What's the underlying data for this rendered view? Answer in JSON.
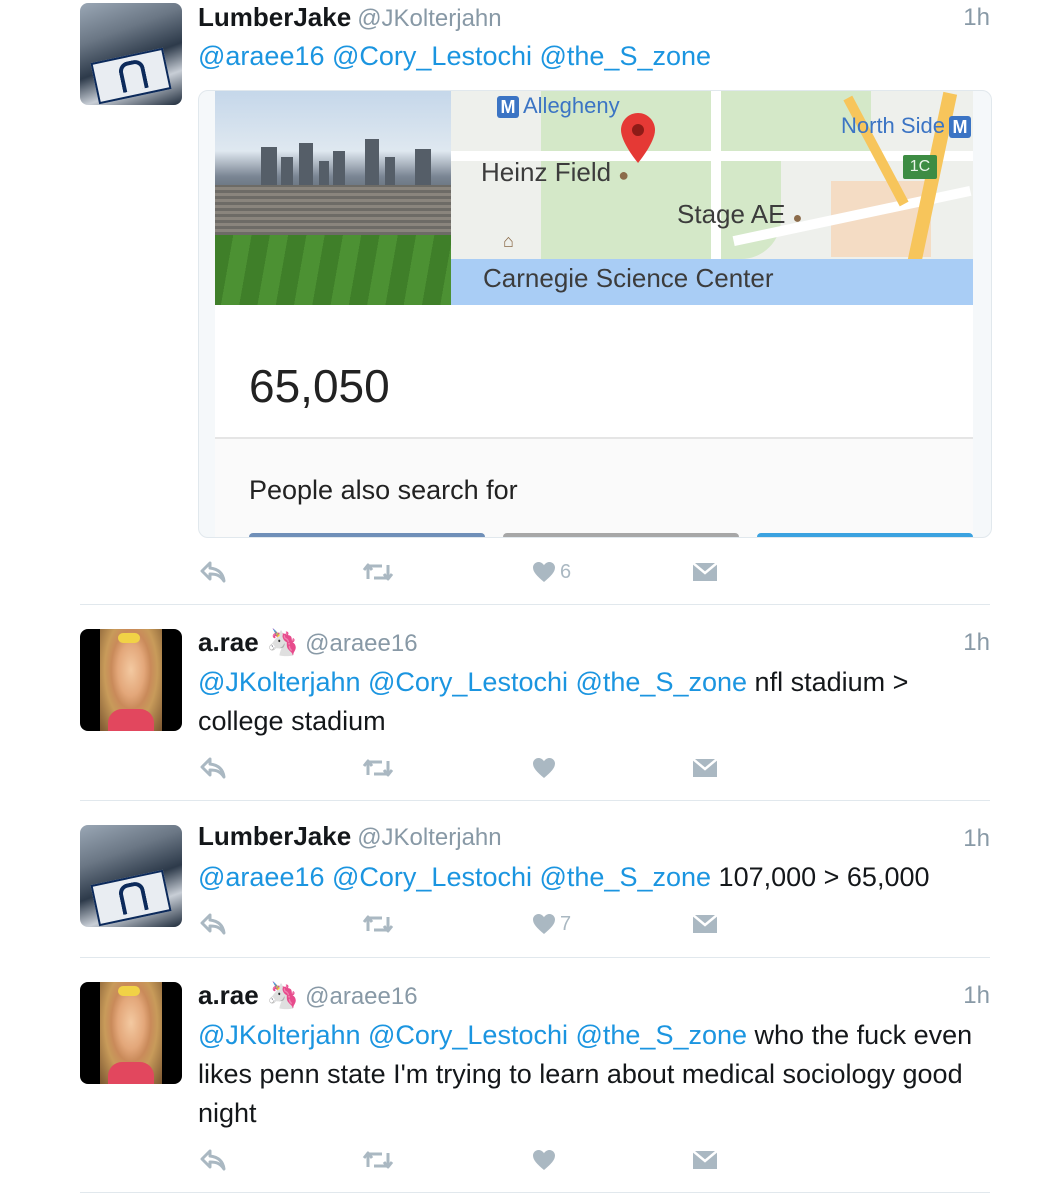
{
  "tweets": [
    {
      "name": "LumberJake",
      "handle": "@JKolterjahn",
      "emoji": "",
      "time": "1h",
      "mentions": "@araee16 @Cory_Lestochi @the_S_zone",
      "text": "",
      "likes": "6",
      "card": {
        "map_labels": {
          "allegheny": "Allegheny",
          "north_side": "North Side",
          "heinz_field": "Heinz Field",
          "stage_ae": "Stage AE",
          "carnegie": "Carnegie Science Center",
          "exit": "1C",
          "metro": "M"
        },
        "number": "65,050",
        "people_also_search": "People also search for"
      }
    },
    {
      "name": "a.rae",
      "handle": "@araee16",
      "emoji": "🦄",
      "time": "1h",
      "mentions": "@JKolterjahn @Cory_Lestochi @the_S_zone",
      "text": "nfl stadium > college stadium",
      "likes": ""
    },
    {
      "name": "LumberJake",
      "handle": "@JKolterjahn",
      "emoji": "",
      "time": "1h",
      "mentions": "@araee16 @Cory_Lestochi @the_S_zone",
      "text": "107,000 > 65,000",
      "likes": "7"
    },
    {
      "name": "a.rae",
      "handle": "@araee16",
      "emoji": "🦄",
      "time": "1h",
      "mentions": "@JKolterjahn @Cory_Lestochi @the_S_zone",
      "text": "who the fuck even likes penn state I'm trying to learn about medical sociology good night",
      "likes": ""
    }
  ],
  "icons": [
    "reply-icon",
    "retweet-icon",
    "heart-icon",
    "direct-message-icon"
  ],
  "colors": {
    "mention": "#1b95e0",
    "icon": "#aab8c2",
    "handle": "#8899a6"
  }
}
